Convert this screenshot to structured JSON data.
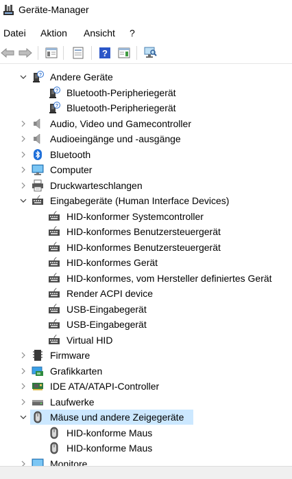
{
  "window": {
    "title": "Geräte-Manager"
  },
  "menu": [
    "Datei",
    "Aktion",
    "Ansicht",
    "?"
  ],
  "toolbar": [
    "back",
    "forward",
    "show-hide-console-tree",
    "properties",
    "help",
    "action-pane",
    "scan-hardware"
  ],
  "tree": [
    {
      "label": "Andere Geräte",
      "level": 0,
      "state": "expanded",
      "icon": "unknown-device-icon"
    },
    {
      "label": "Bluetooth-Peripheriegerät",
      "level": 1,
      "icon": "unknown-device-icon"
    },
    {
      "label": "Bluetooth-Peripheriegerät",
      "level": 1,
      "icon": "unknown-device-icon"
    },
    {
      "label": "Audio, Video und Gamecontroller",
      "level": 0,
      "state": "collapsed",
      "icon": "speaker-icon"
    },
    {
      "label": "Audioeingänge und -ausgänge",
      "level": 0,
      "state": "collapsed",
      "icon": "speaker-icon"
    },
    {
      "label": "Bluetooth",
      "level": 0,
      "state": "collapsed",
      "icon": "bluetooth-icon"
    },
    {
      "label": "Computer",
      "level": 0,
      "state": "collapsed",
      "icon": "monitor-icon"
    },
    {
      "label": "Druckwarteschlangen",
      "level": 0,
      "state": "collapsed",
      "icon": "printer-icon"
    },
    {
      "label": "Eingabegeräte (Human Interface Devices)",
      "level": 0,
      "state": "expanded",
      "icon": "hid-icon"
    },
    {
      "label": "HID-konformer Systemcontroller",
      "level": 1,
      "icon": "hid-icon"
    },
    {
      "label": "HID-konformes Benutzersteuergerät",
      "level": 1,
      "icon": "hid-icon"
    },
    {
      "label": "HID-konformes Benutzersteuergerät",
      "level": 1,
      "icon": "hid-icon"
    },
    {
      "label": "HID-konformes Gerät",
      "level": 1,
      "icon": "hid-icon"
    },
    {
      "label": "HID-konformes, vom Hersteller definiertes Gerät",
      "level": 1,
      "icon": "hid-icon"
    },
    {
      "label": "Render ACPI device",
      "level": 1,
      "icon": "hid-icon"
    },
    {
      "label": "USB-Eingabegerät",
      "level": 1,
      "icon": "hid-icon"
    },
    {
      "label": "USB-Eingabegerät",
      "level": 1,
      "icon": "hid-icon"
    },
    {
      "label": "Virtual HID",
      "level": 1,
      "icon": "hid-icon"
    },
    {
      "label": "Firmware",
      "level": 0,
      "state": "collapsed",
      "icon": "firmware-icon"
    },
    {
      "label": "Grafikkarten",
      "level": 0,
      "state": "collapsed",
      "icon": "display-adapter-icon"
    },
    {
      "label": "IDE ATA/ATAPI-Controller",
      "level": 0,
      "state": "collapsed",
      "icon": "ide-controller-icon"
    },
    {
      "label": "Laufwerke",
      "level": 0,
      "state": "collapsed",
      "icon": "drive-icon"
    },
    {
      "label": "Mäuse und andere Zeigegeräte",
      "level": 0,
      "state": "expanded",
      "icon": "mouse-icon",
      "selected": true
    },
    {
      "label": "HID-konforme Maus",
      "level": 1,
      "icon": "mouse-icon"
    },
    {
      "label": "HID-konforme Maus",
      "level": 1,
      "icon": "mouse-icon"
    },
    {
      "label": "Monitore",
      "level": 0,
      "state": "collapsed",
      "icon": "monitor-icon"
    }
  ],
  "colors": {
    "selection": "#cce8ff",
    "bluetooth": "#1e6fd9"
  }
}
